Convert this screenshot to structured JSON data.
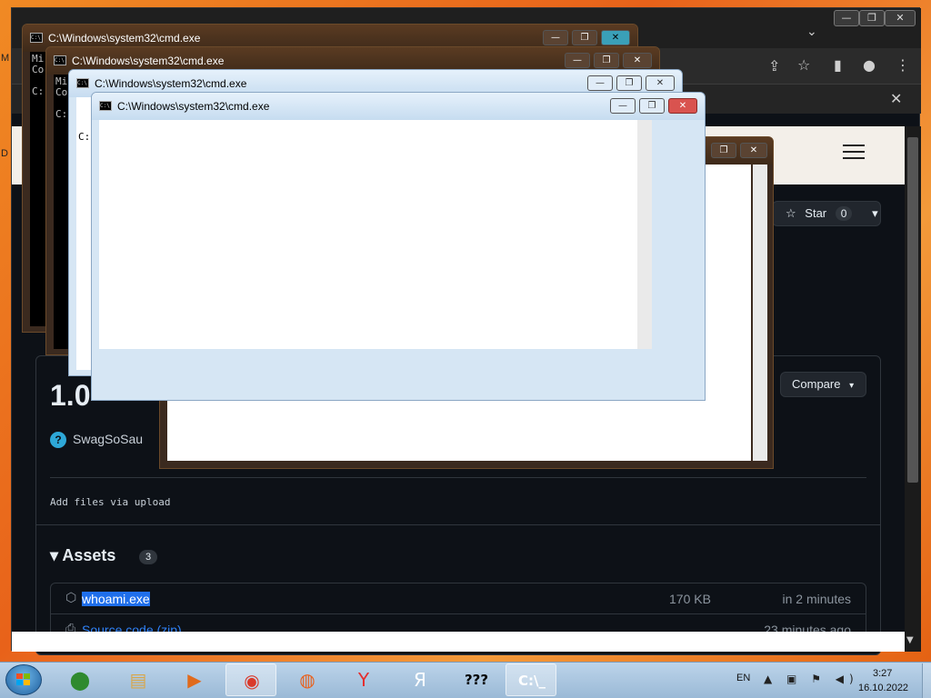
{
  "desktop": {
    "label_a": "M",
    "label_b": "D"
  },
  "browser": {
    "win_minimize": "—",
    "win_restore": "❐",
    "win_close": "✕",
    "tab_dropdown": "⌄",
    "toolbar_icons": {
      "share": "⇪",
      "star": "☆",
      "sidebar": "▮",
      "profile": "●",
      "menu": "⋮"
    },
    "infobar_close": "✕",
    "github": {
      "star_label": "Star",
      "star_count": "0",
      "star_dropdown": "▾",
      "release_version": "1.0",
      "author_avatar": "?",
      "author": "SwagSoSau",
      "compare_label": "Compare",
      "compare_caret": "▾",
      "release_body": "Add files via upload",
      "assets_heading": "▾ Assets",
      "assets_count": "3",
      "assets": [
        {
          "icon": "⬡",
          "name": "whoami.exe",
          "size": "170 KB",
          "time": "in 2 minutes"
        },
        {
          "icon": "⎙",
          "name": "Source code (zip)",
          "size": "",
          "time": "23 minutes ago"
        }
      ]
    }
  },
  "cmd_windows": [
    {
      "title": "C:\\Windows\\system32\\cmd.exe",
      "body_lines": [
        "Mi",
        "Co",
        "",
        "C:"
      ]
    },
    {
      "title": "C:\\Windows\\system32\\cmd.exe",
      "body_lines": [
        "Mi",
        "Co",
        "",
        "C:"
      ]
    },
    {
      "title": "C:\\Windows\\system32\\cmd.exe",
      "body_lines": [
        "",
        "",
        "",
        "C:"
      ]
    },
    {
      "title": "C:\\Windows\\system32\\cmd.exe",
      "body_lines": []
    }
  ],
  "cmd_controls": {
    "minimize": "—",
    "maximize": "❐",
    "close": "✕"
  },
  "taskbar": {
    "items": [
      {
        "name": "green-app",
        "glyph": "⬤",
        "color": "#2f8a2f",
        "active": false
      },
      {
        "name": "explorer",
        "glyph": "▤",
        "color": "#d8a64a",
        "active": false
      },
      {
        "name": "media-player",
        "glyph": "▶",
        "color": "#e06a1c",
        "active": false
      },
      {
        "name": "chrome",
        "glyph": "◉",
        "color": "#d93a2b",
        "active": true
      },
      {
        "name": "firefox",
        "glyph": "◍",
        "color": "#e8601c",
        "active": false
      },
      {
        "name": "yandex-browser",
        "glyph": "Y",
        "color": "#e52d2d",
        "active": false
      },
      {
        "name": "yandex",
        "glyph": "Я",
        "color": "#ffffff",
        "active": false
      },
      {
        "name": "unknown-app",
        "glyph": "???",
        "color": "#000000",
        "active": false
      },
      {
        "name": "cmd",
        "glyph": "C:\\_",
        "color": "#ffffff",
        "active": true
      }
    ],
    "tray_lang": "EN",
    "tray_icons": "▲ ▣ ⚑ ◀)",
    "clock_time": "3:27",
    "clock_date": "16.10.2022"
  }
}
